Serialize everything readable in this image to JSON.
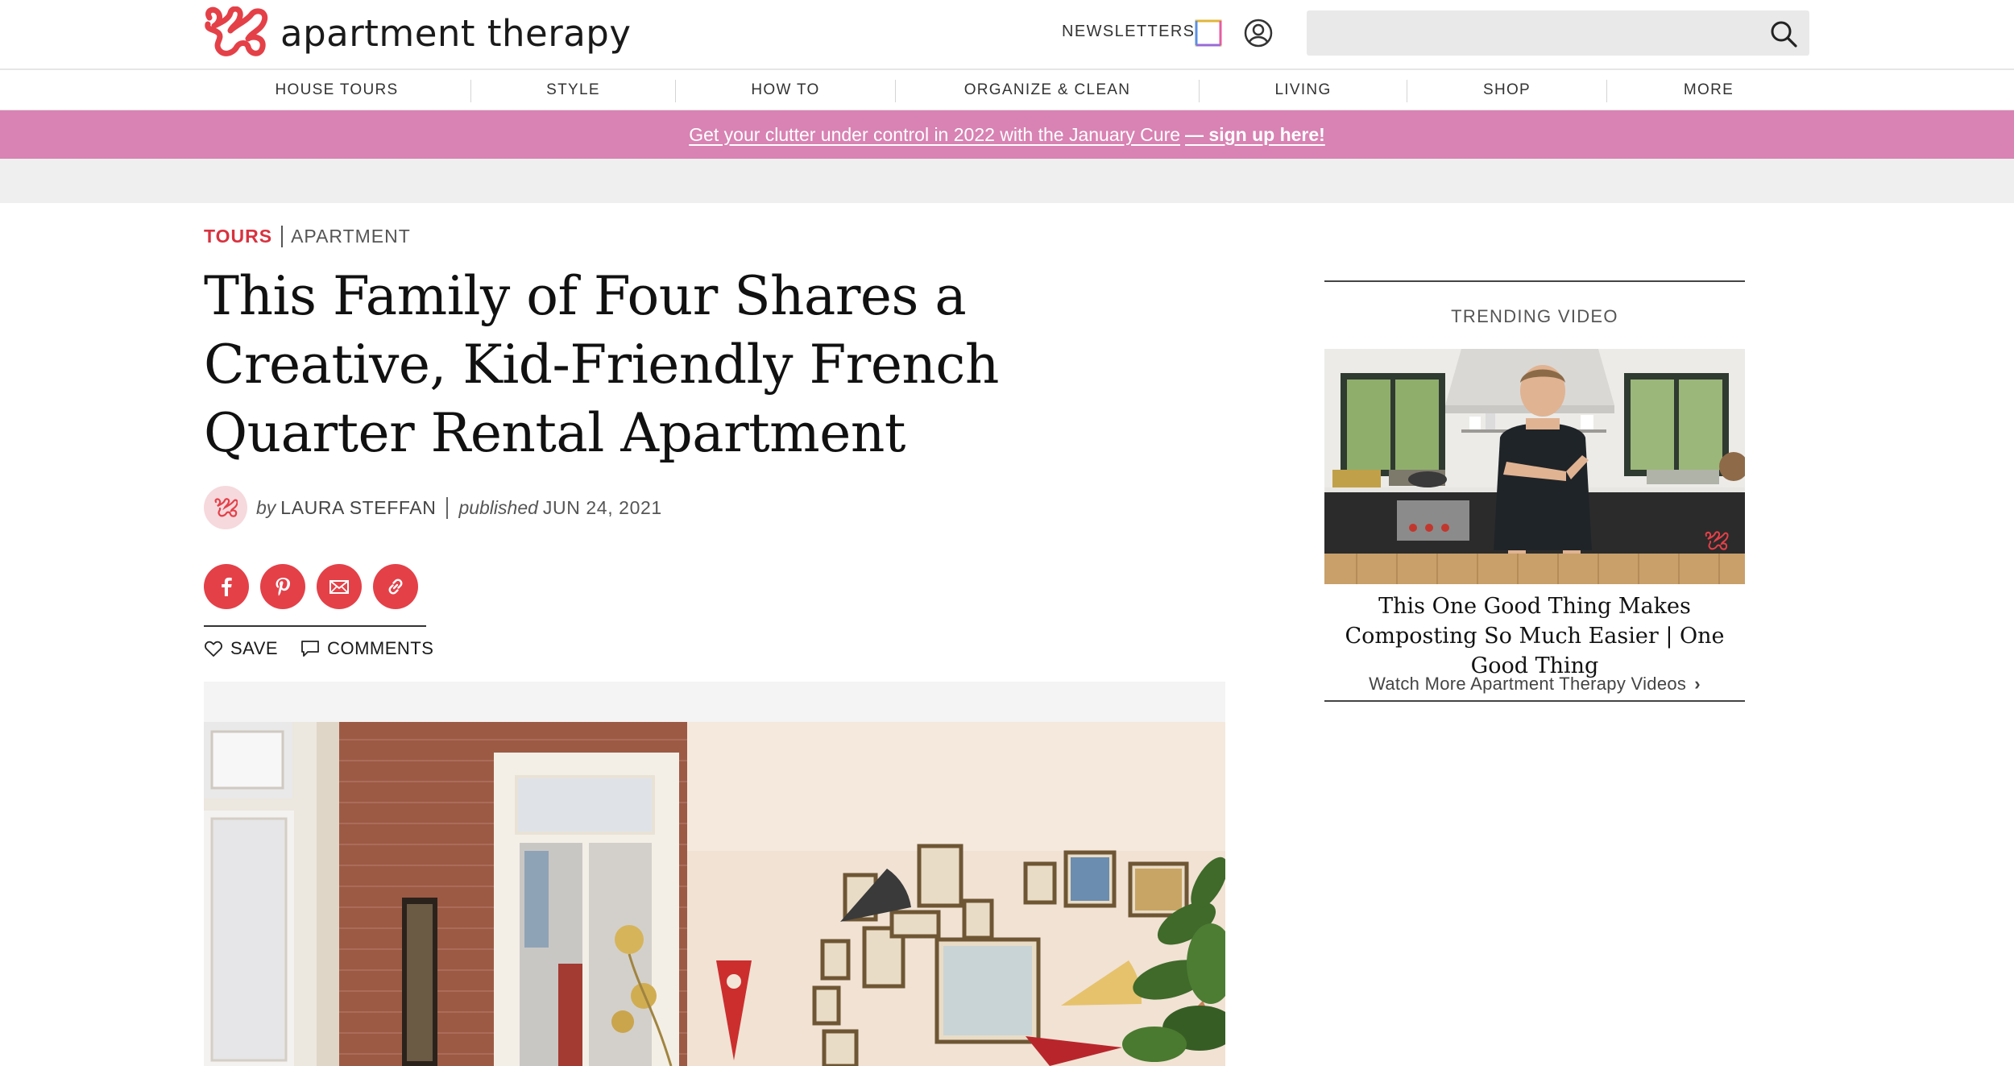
{
  "header": {
    "logo_text": "apartment therapy",
    "newsletters_label": "NEWSLETTERS",
    "search_placeholder": ""
  },
  "nav": {
    "items": [
      {
        "label": "HOUSE TOURS"
      },
      {
        "label": "STYLE"
      },
      {
        "label": "HOW TO"
      },
      {
        "label": "ORGANIZE & CLEAN"
      },
      {
        "label": "LIVING"
      },
      {
        "label": "SHOP"
      },
      {
        "label": "MORE"
      }
    ]
  },
  "promo": {
    "text": "Get your clutter under control in 2022 with the January Cure",
    "cta": "— sign up here!",
    "background": "#d883b3"
  },
  "article": {
    "category_primary": "TOURS",
    "category_secondary": "APARTMENT",
    "title": "This Family of Four Shares a Creative, Kid-Friendly French Quarter Rental Apartment",
    "byline_prefix": "by",
    "author": "LAURA STEFFAN",
    "published_prefix": "published",
    "published_date": "JUN 24, 2021",
    "share": [
      {
        "icon": "facebook-icon"
      },
      {
        "icon": "pinterest-icon"
      },
      {
        "icon": "email-icon"
      },
      {
        "icon": "link-icon"
      }
    ],
    "save_label": "SAVE",
    "comments_label": "COMMENTS"
  },
  "sidebar": {
    "label": "TRENDING VIDEO",
    "video_title": "This One Good Thing Makes Composting So Much Easier | One Good Thing",
    "more_link": "Watch More Apartment Therapy Videos",
    "more_chevron": "›"
  },
  "colors": {
    "brand_red": "#e44048",
    "tours_red": "#d8323f",
    "promo_pink": "#d883b3"
  }
}
